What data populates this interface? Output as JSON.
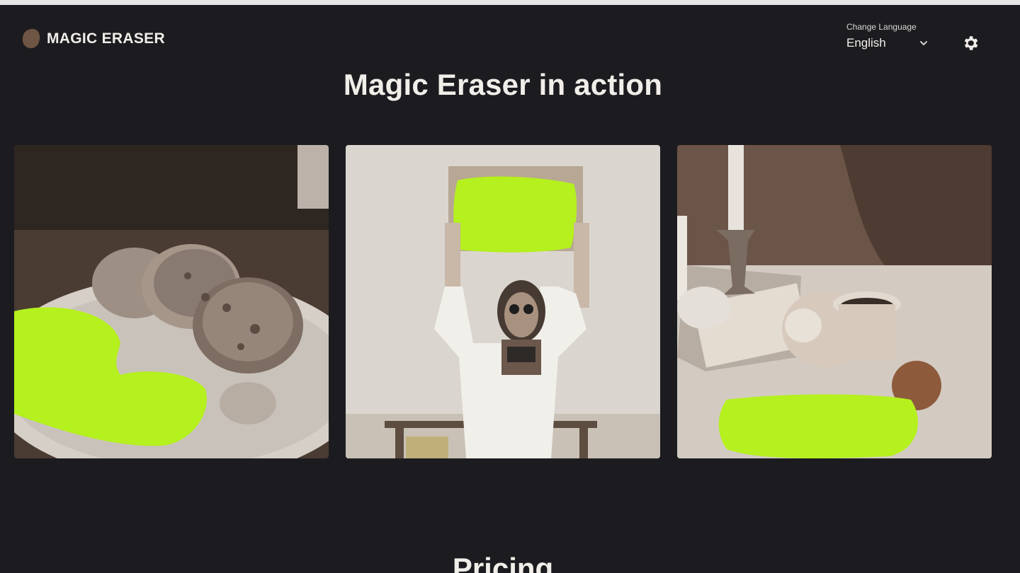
{
  "brand": {
    "name": "MAGIC ERASER",
    "logo_icon": "blob-icon",
    "logo_color": "#6f5544"
  },
  "language": {
    "caption": "Change Language",
    "selected": "English"
  },
  "settings": {
    "icon": "gear-icon"
  },
  "showcase": {
    "title": "Magic Eraser in action",
    "images": [
      {
        "subject": "bread-plate-photo"
      },
      {
        "subject": "person-with-sign-photo"
      },
      {
        "subject": "coffee-table-photo"
      }
    ],
    "mask_color": "#b5f01f"
  },
  "pricing": {
    "title": "Pricing"
  },
  "colors": {
    "background": "#1c1c20",
    "text": "#f1ede9"
  }
}
